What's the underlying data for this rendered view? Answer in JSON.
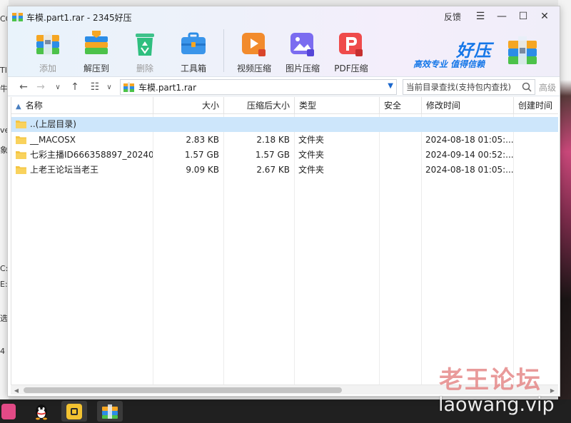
{
  "window": {
    "title": "车模.part1.rar - 2345好压",
    "mirror_label": "反馈",
    "menu_symbol": "☰",
    "minimize_symbol": "—",
    "maximize_symbol": "☐",
    "close_symbol": "✕"
  },
  "toolbar": {
    "add": "添加",
    "extract": "解压到",
    "delete": "删除",
    "toolbox": "工具箱",
    "video": "视频压缩",
    "image": "图片压缩",
    "pdf": "PDF压缩"
  },
  "brand": {
    "name": "好压",
    "slogan": "高效专业 值得信赖"
  },
  "address": {
    "back": "←",
    "forward": "→",
    "history": "∨",
    "up": "↑",
    "view": "☷",
    "view_drop": "∨",
    "path": "车模.part1.rar",
    "dropdown": "▼",
    "search_placeholder": "当前目录查找(支持包内查找)",
    "advanced": "高级"
  },
  "columns": {
    "name": "名称",
    "size": "大小",
    "packed": "压缩后大小",
    "type": "类型",
    "security": "安全",
    "modified": "修改时间",
    "created": "创建时间"
  },
  "rows": [
    {
      "name": "..(上层目录)",
      "size": "",
      "packed": "",
      "type": "",
      "security": "",
      "modified": "",
      "created": ""
    },
    {
      "name": "__MACOSX",
      "size": "2.83 KB",
      "packed": "2.18 KB",
      "type": "文件夹",
      "security": "",
      "modified": "2024-08-18 01:05:...",
      "created": ""
    },
    {
      "name": "七彩主播ID666358897_20240...",
      "size": "1.57 GB",
      "packed": "1.57 GB",
      "type": "文件夹",
      "security": "",
      "modified": "2024-09-14 00:52:...",
      "created": ""
    },
    {
      "name": "上老王论坛当老王",
      "size": "9.09 KB",
      "packed": "2.67 KB",
      "type": "文件夹",
      "security": "",
      "modified": "2024-08-18 01:05:...",
      "created": ""
    }
  ],
  "watermark": {
    "cn": "老王论坛",
    "url": "laowang.vip"
  },
  "desktop_left_fragments": [
    "CC",
    "Tl",
    "牛",
    "ve",
    "象",
    "C:",
    "E:",
    "选",
    "4"
  ],
  "colors": {
    "accent": "#1677e8",
    "selected_row": "#cde6fb",
    "folder": "#f5c542"
  }
}
